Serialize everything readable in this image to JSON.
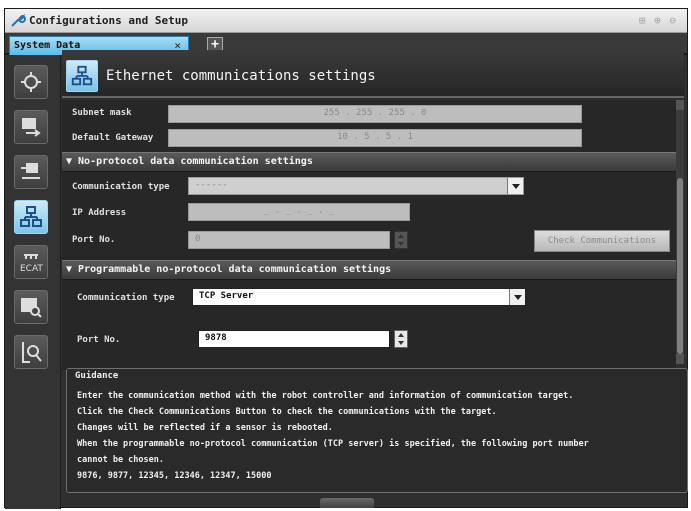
{
  "window": {
    "title": "Configurations and Setup",
    "controls": "⊞ ⊕ ⊖"
  },
  "tabs": [
    {
      "label": "System Data",
      "close": "×"
    }
  ],
  "tab_add": "+",
  "sidebar": {
    "items": [
      {
        "name": "settings-icon"
      },
      {
        "name": "device-icon"
      },
      {
        "name": "io-icon"
      },
      {
        "name": "network-icon",
        "active": true
      },
      {
        "name": "ecat-icon",
        "label": "ECAT"
      },
      {
        "name": "window-search-icon"
      },
      {
        "name": "inspect-icon"
      }
    ]
  },
  "header": {
    "title": "Ethernet communications settings"
  },
  "network": {
    "subnet_label": "Subnet mask",
    "subnet_value": "255 . 255 . 255 . 0",
    "gateway_label": "Default Gateway",
    "gateway_value": "10 . 5 . 5 . 1"
  },
  "no_protocol": {
    "header": "▼ No-protocol data communication settings",
    "comm_type_label": "Communication type",
    "comm_type_value": "------",
    "ip_label": "IP Address",
    "ip_value": "_ . _ . _ . _",
    "port_label": "Port No.",
    "port_value": "0",
    "check_button": "Check Communications"
  },
  "programmable": {
    "header": "▼ Programmable no-protocol data communication settings",
    "comm_type_label": "Communication type",
    "comm_type_value": "TCP Server",
    "port_label": "Port No.",
    "port_value": "9878"
  },
  "guidance": {
    "title": "Guidance",
    "lines": [
      "Enter the communication method with the robot controller and information of communication target.",
      "Click the Check Communications Button to check the communications with the target.",
      "Changes will be reflected if a sensor is rebooted.",
      "When the programmable no-protocol communication (TCP server) is specified, the following port number",
      "cannot be chosen.",
      "9876, 9877, 12345, 12346, 12347, 15000"
    ]
  },
  "colors": {
    "accent": "#5cbde8",
    "background": "#2f2f2f"
  }
}
